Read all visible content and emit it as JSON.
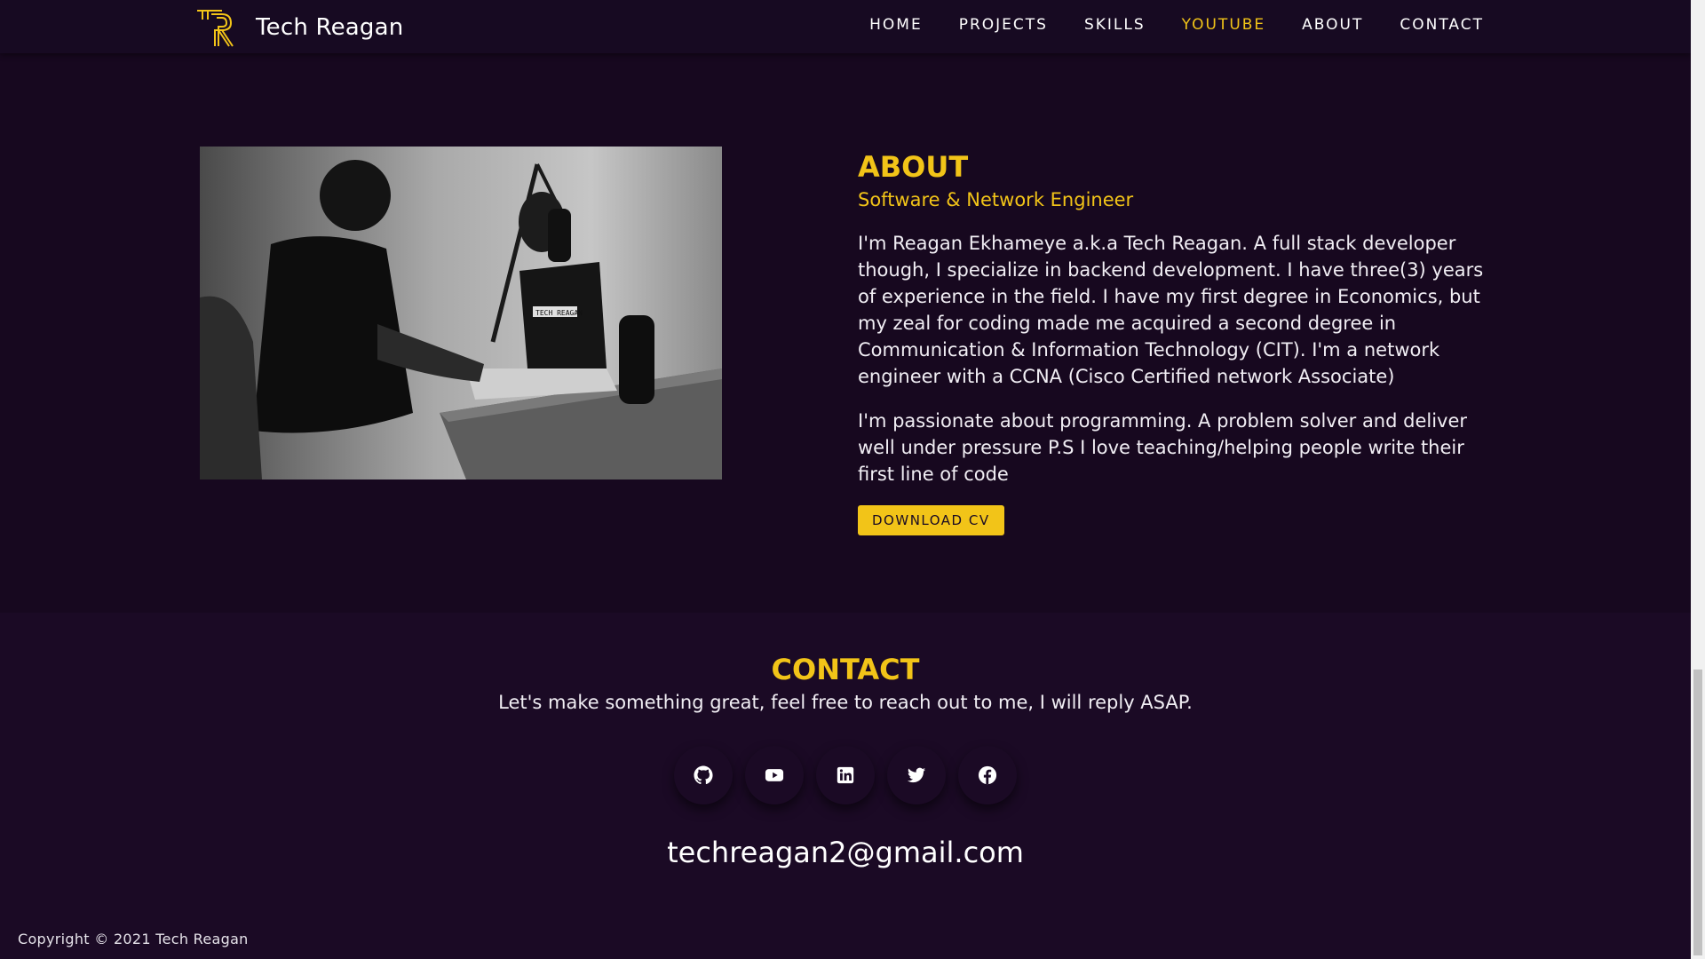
{
  "navbar": {
    "brand_name": "Tech Reagan",
    "links": [
      {
        "label": "HOME",
        "active": false
      },
      {
        "label": "PROJECTS",
        "active": false
      },
      {
        "label": "SKILLS",
        "active": false
      },
      {
        "label": "YOUTUBE",
        "active": true
      },
      {
        "label": "ABOUT",
        "active": false
      },
      {
        "label": "CONTACT",
        "active": false
      }
    ],
    "logo_icon": "tr-monogram-logo"
  },
  "about": {
    "title": "ABOUT",
    "subtitle": "Software & Network Engineer",
    "paragraph_1": "I'm Reagan Ekhameye a.k.a Tech Reagan. A full stack developer though, I specialize in backend development. I have three(3) years of experience in the field. I have my first degree in Economics, but my zeal for coding made me acquired a second degree in Communication & Information Technology (CIT). I'm a network engineer with a CCNA (Cisco Certified network Associate)",
    "paragraph_2": "I'm passionate about programming. A problem solver and deliver well under pressure P.S I love teaching/helping people write their first line of code",
    "cv_button": "DOWNLOAD CV",
    "photo_screen_text": "TECH REAGAN"
  },
  "contact": {
    "title": "CONTACT",
    "subtitle": "Let's make something great, feel free to reach out to me, I will reply ASAP.",
    "socials": [
      {
        "name": "github",
        "icon": "github-icon"
      },
      {
        "name": "youtube",
        "icon": "youtube-icon"
      },
      {
        "name": "linkedin",
        "icon": "linkedin-icon"
      },
      {
        "name": "twitter",
        "icon": "twitter-icon"
      },
      {
        "name": "facebook",
        "icon": "facebook-icon"
      }
    ],
    "email": "techreagan2@gmail.com"
  },
  "footer": {
    "copyright": "Copyright © 2021 Tech Reagan"
  },
  "colors": {
    "background": "#17081f",
    "accent": "#f2c418",
    "text": "#ffffff"
  }
}
